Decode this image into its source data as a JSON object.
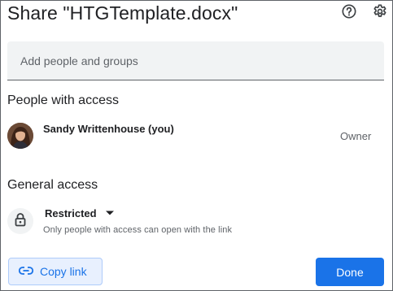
{
  "dialog": {
    "title": "Share \"HTGTemplate.docx\"",
    "help_icon": "help-circle-icon",
    "settings_icon": "gear-icon"
  },
  "add_people": {
    "placeholder": "Add people and groups",
    "value": ""
  },
  "people_section": {
    "title": "People with access",
    "people": [
      {
        "name": "Sandy Writtenhouse (you)",
        "role": "Owner",
        "avatar": "user-avatar-photo"
      }
    ]
  },
  "general_access": {
    "title": "General access",
    "icon": "lock-icon",
    "selected": "Restricted",
    "description": "Only people with access can open with the link"
  },
  "footer": {
    "copy_link_label": "Copy link",
    "copy_link_icon": "link-icon",
    "done_label": "Done"
  },
  "colors": {
    "primary": "#1a73e8",
    "copy_bg": "#e8f0fe",
    "input_bg": "#f1f3f4",
    "secondary_text": "#5f6368"
  }
}
